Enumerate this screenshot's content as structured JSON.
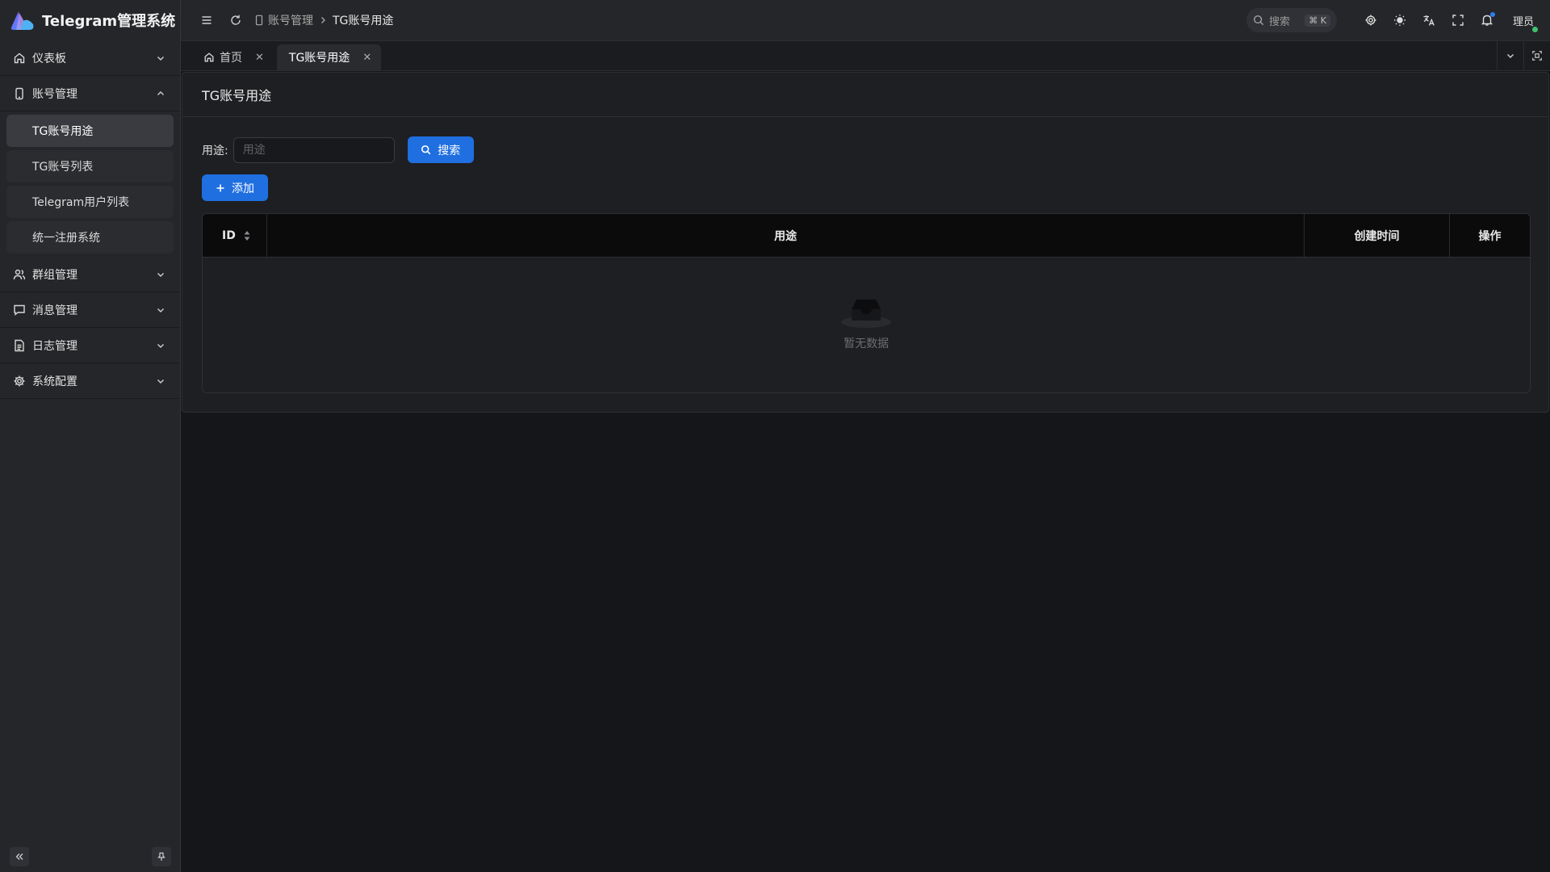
{
  "app": {
    "title": "Telegram管理系统"
  },
  "sidebar": {
    "groups": [
      {
        "label": "仪表板",
        "icon": "home-icon",
        "expanded": false
      },
      {
        "label": "账号管理",
        "icon": "phone-icon",
        "expanded": true,
        "items": [
          {
            "label": "TG账号用途",
            "active": true
          },
          {
            "label": "TG账号列表",
            "active": false
          },
          {
            "label": "Telegram用户列表",
            "active": false
          },
          {
            "label": "统一注册系统",
            "active": false
          }
        ]
      },
      {
        "label": "群组管理",
        "icon": "users-icon",
        "expanded": false
      },
      {
        "label": "消息管理",
        "icon": "message-icon",
        "expanded": false
      },
      {
        "label": "日志管理",
        "icon": "file-icon",
        "expanded": false
      },
      {
        "label": "系统配置",
        "icon": "gear-icon",
        "expanded": false
      }
    ]
  },
  "header": {
    "breadcrumb": {
      "parent": "账号管理",
      "current": "TG账号用途"
    },
    "search": {
      "placeholder": "搜索",
      "shortcut": "⌘ K"
    },
    "user": "理员"
  },
  "tabs": [
    {
      "label": "首页",
      "icon": "home-icon",
      "active": false
    },
    {
      "label": "TG账号用途",
      "active": true
    }
  ],
  "page": {
    "title": "TG账号用途",
    "filter": {
      "label": "用途",
      "placeholder": "用途",
      "value": ""
    },
    "search_button": "搜索",
    "add_button": "添加",
    "table": {
      "columns": [
        "ID",
        "用途",
        "创建时间",
        "操作"
      ],
      "rows": [],
      "empty_text": "暂无数据"
    }
  },
  "colors": {
    "accent": "#1f6fe0",
    "background": "#151619",
    "sidebar": "#252629",
    "online": "#3fc26d"
  }
}
